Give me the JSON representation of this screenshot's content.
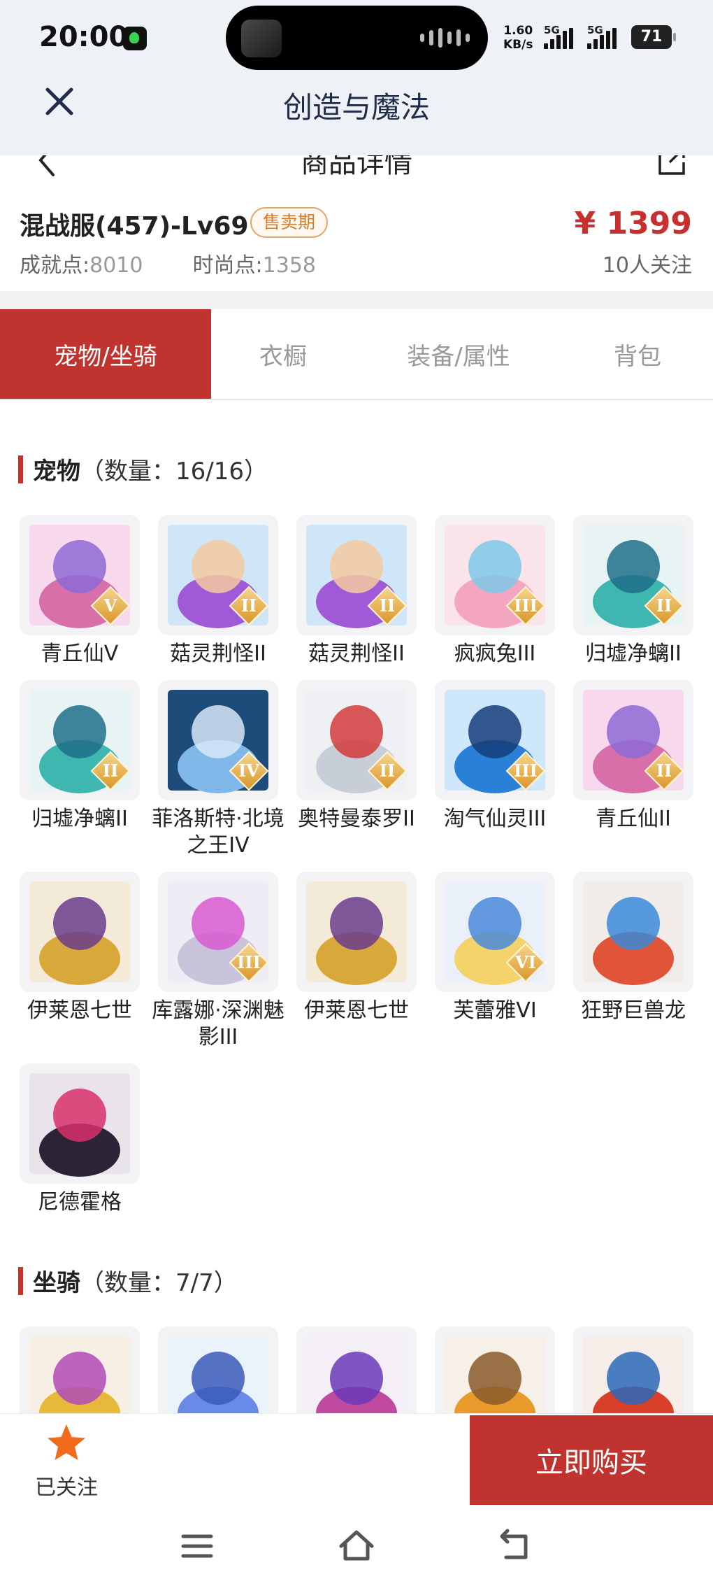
{
  "status_bar": {
    "time": "20:00",
    "net_speed_value": "1.60",
    "net_speed_unit": "KB/s",
    "signal1_label": "5G",
    "signal2_label": "5G",
    "battery": "71"
  },
  "app_header": {
    "title": "创造与魔法",
    "close_icon": "close-icon"
  },
  "page_nav": {
    "title": "商品详情",
    "back_icon": "chevron-left-icon",
    "share_icon": "share-icon"
  },
  "product": {
    "name": "混战服(457)-Lv69",
    "sale_tag": "售卖期",
    "achievement_label": "成就点:",
    "achievement_value": "8010",
    "fashion_label": "时尚点:",
    "fashion_value": "1358",
    "price": "¥ 1399",
    "followers": "10人关注"
  },
  "tabs": [
    {
      "label": "宠物/坐骑",
      "active": true
    },
    {
      "label": "衣橱",
      "active": false
    },
    {
      "label": "装备/属性",
      "active": false
    },
    {
      "label": "背包",
      "active": false
    }
  ],
  "pets": {
    "title": "宠物",
    "count": "（数量：16/16）",
    "items": [
      {
        "name": "青丘仙V",
        "rank": "V",
        "palette": [
          "#f7d8ec",
          "#d86fa8",
          "#8e6bd6"
        ]
      },
      {
        "name": "菇灵荆怪II",
        "rank": "II",
        "palette": [
          "#cfe6f8",
          "#a05ad8",
          "#f5c9a0"
        ]
      },
      {
        "name": "菇灵荆怪II",
        "rank": "II",
        "palette": [
          "#cfe6f8",
          "#a05ad8",
          "#f5c9a0"
        ]
      },
      {
        "name": "疯疯兔III",
        "rank": "III",
        "palette": [
          "#fbe3ea",
          "#f4a6c0",
          "#7ec8e8"
        ]
      },
      {
        "name": "归墟净螭II",
        "rank": "II",
        "palette": [
          "#e8f4f4",
          "#3fb7b0",
          "#1f6f8a"
        ]
      },
      {
        "name": "归墟净螭II",
        "rank": "II",
        "palette": [
          "#e8f4f4",
          "#3fb7b0",
          "#1f6f8a"
        ]
      },
      {
        "name": "菲洛斯特·北境之王IV",
        "rank": "IV",
        "palette": [
          "#1d4c7a",
          "#7fb8e8",
          "#d8e8f8"
        ]
      },
      {
        "name": "奥特曼泰罗II",
        "rank": "II",
        "palette": [
          "#eef0f4",
          "#c8ced8",
          "#d23b3b"
        ]
      },
      {
        "name": "淘气仙灵III",
        "rank": "III",
        "palette": [
          "#cfe7fa",
          "#2a7fd6",
          "#153d7a"
        ]
      },
      {
        "name": "青丘仙II",
        "rank": "II",
        "palette": [
          "#f7d8ec",
          "#d86fa8",
          "#8e6bd6"
        ]
      },
      {
        "name": "伊莱恩七世",
        "rank": "",
        "palette": [
          "#f4ead8",
          "#d9a83a",
          "#6a3c8c"
        ]
      },
      {
        "name": "库露娜·深渊魅影III",
        "rank": "III",
        "palette": [
          "#f0ecf6",
          "#c9c3dc",
          "#d85ad0"
        ]
      },
      {
        "name": "伊莱恩七世",
        "rank": "",
        "palette": [
          "#f4ead8",
          "#d9a83a",
          "#6a3c8c"
        ]
      },
      {
        "name": "芙蕾雅VI",
        "rank": "VI",
        "palette": [
          "#e9f0fa",
          "#f3d36a",
          "#4a8ad8"
        ]
      },
      {
        "name": "狂野巨兽龙",
        "rank": "",
        "palette": [
          "#f2ece8",
          "#e0553a",
          "#3a8ad8"
        ]
      },
      {
        "name": "尼德霍格",
        "rank": "",
        "palette": [
          "#e8e4ea",
          "#2a2436",
          "#d8306a"
        ]
      }
    ]
  },
  "mounts": {
    "title": "坐骑",
    "count": "（数量：7/7）",
    "items": [
      {
        "palette": [
          "#f8efe4",
          "#e7b93a",
          "#b04ab8"
        ]
      },
      {
        "palette": [
          "#eaf2fa",
          "#6a8ae8",
          "#3a5ab8"
        ]
      },
      {
        "palette": [
          "#f4eef6",
          "#c04aa0",
          "#6a3ab8"
        ]
      },
      {
        "palette": [
          "#f6f0e8",
          "#e89a2a",
          "#8a5a2a"
        ]
      },
      {
        "palette": [
          "#f6ece8",
          "#d8402a",
          "#2a6ab8"
        ]
      }
    ]
  },
  "action_bar": {
    "follow_label": "已关注",
    "buy_label": "立即购买"
  },
  "colors": {
    "accent": "#c0332f",
    "price": "#c8302f",
    "sale_tag": "#d67a2a"
  }
}
